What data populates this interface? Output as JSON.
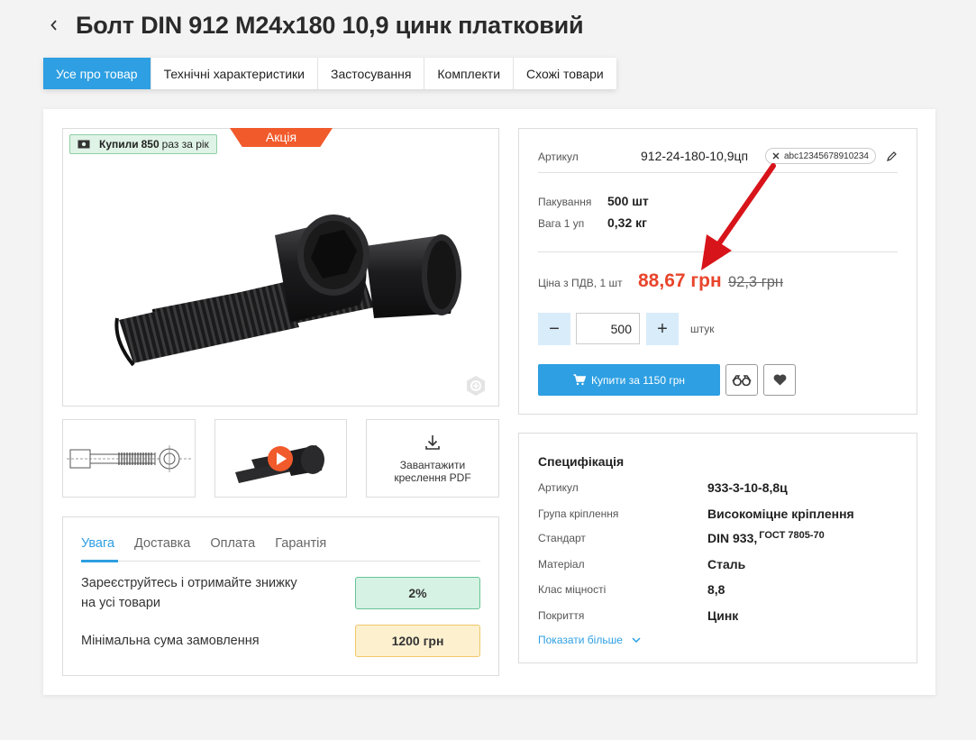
{
  "header": {
    "back_icon": "chevron-left-icon",
    "title": "Болт DIN 912 M24x180 10,9 цинк платковий"
  },
  "tabs": [
    {
      "label": "Усе про товар",
      "active": true
    },
    {
      "label": "Технічні характеристики"
    },
    {
      "label": "Застосування"
    },
    {
      "label": "Комплекти"
    },
    {
      "label": "Схожі товари"
    }
  ],
  "gallery": {
    "badge_prefix": "Купили",
    "badge_count": "850",
    "badge_suffix": "раз за рік",
    "promo_label": "Акція",
    "download_label_1": "Завантажити",
    "download_label_2": "креслення PDF"
  },
  "info": {
    "tabs": [
      "Увага",
      "Доставка",
      "Оплата",
      "Гарантія"
    ],
    "row1_text_1": "Зареєструйтесь і отримайте знижку",
    "row1_text_2": "на усі товари",
    "row1_value": "2%",
    "row2_text": "Мінімальна сума замовлення",
    "row2_value": "1200 грн"
  },
  "product": {
    "article_label": "Артикул",
    "article_value": "912-24-180-10,9цп",
    "code_tag": "abc12345678910234",
    "packing_label": "Пакування",
    "packing_value": "500 шт",
    "weight_label": "Вага 1 уп",
    "weight_value": "0,32 кг",
    "price_label": "Ціна з ПДВ, 1 шт",
    "price": "88,67 грн",
    "old_price": "92,3 грн",
    "qty_minus": "−",
    "qty_value": "500",
    "qty_plus": "+",
    "qty_unit": "штук",
    "buy_label": "Купити за 1150 грн"
  },
  "spec": {
    "title": "Специфікація",
    "rows": [
      {
        "label": "Артикул",
        "value": "933-3-10-8,8ц"
      },
      {
        "label": "Група кріплення",
        "value": "Високоміцне кріплення"
      },
      {
        "label": "Стандарт",
        "value": "DIN 933,",
        "value_small": "ГОСТ 7805-70"
      },
      {
        "label": "Матеріал",
        "value": "Сталь"
      },
      {
        "label": "Клас міцності",
        "value": "8,8"
      },
      {
        "label": "Покриття",
        "value": "Цинк"
      }
    ],
    "show_more": "Показати більше"
  },
  "colors": {
    "accent": "#2d9fe2",
    "price": "#e8452c",
    "promo": "#f15a2b",
    "arrow": "#d8141b"
  }
}
